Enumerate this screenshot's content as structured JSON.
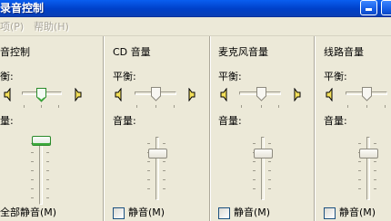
{
  "window": {
    "title": "录音控制"
  },
  "menubar": {
    "items": [
      {
        "label": "项(P)"
      },
      {
        "label": "帮助(H)"
      }
    ]
  },
  "columns": [
    {
      "name": "音控制",
      "balance_label": "衡:",
      "volume_label": "量:",
      "select_label": "全部静音(M)"
    },
    {
      "name": "CD 音量",
      "balance_label": "平衡:",
      "volume_label": "音量:",
      "select_label": "静音(M)"
    },
    {
      "name": "麦克风音量",
      "balance_label": "平衡:",
      "volume_label": "音量:",
      "select_label": "静音(M)"
    },
    {
      "name": "线路音量",
      "balance_label": "平衡:",
      "volume_label": "音量:",
      "select_label": "静音(M)"
    }
  ],
  "colors": {
    "title_bar": "#0a5ef0",
    "window_bg": "#ece9d8",
    "focus_thumb": "#3caa3c"
  },
  "icons": {
    "speaker_left": "speaker-left-icon",
    "speaker_right": "speaker-right-icon",
    "minimize": "minimize-icon"
  }
}
